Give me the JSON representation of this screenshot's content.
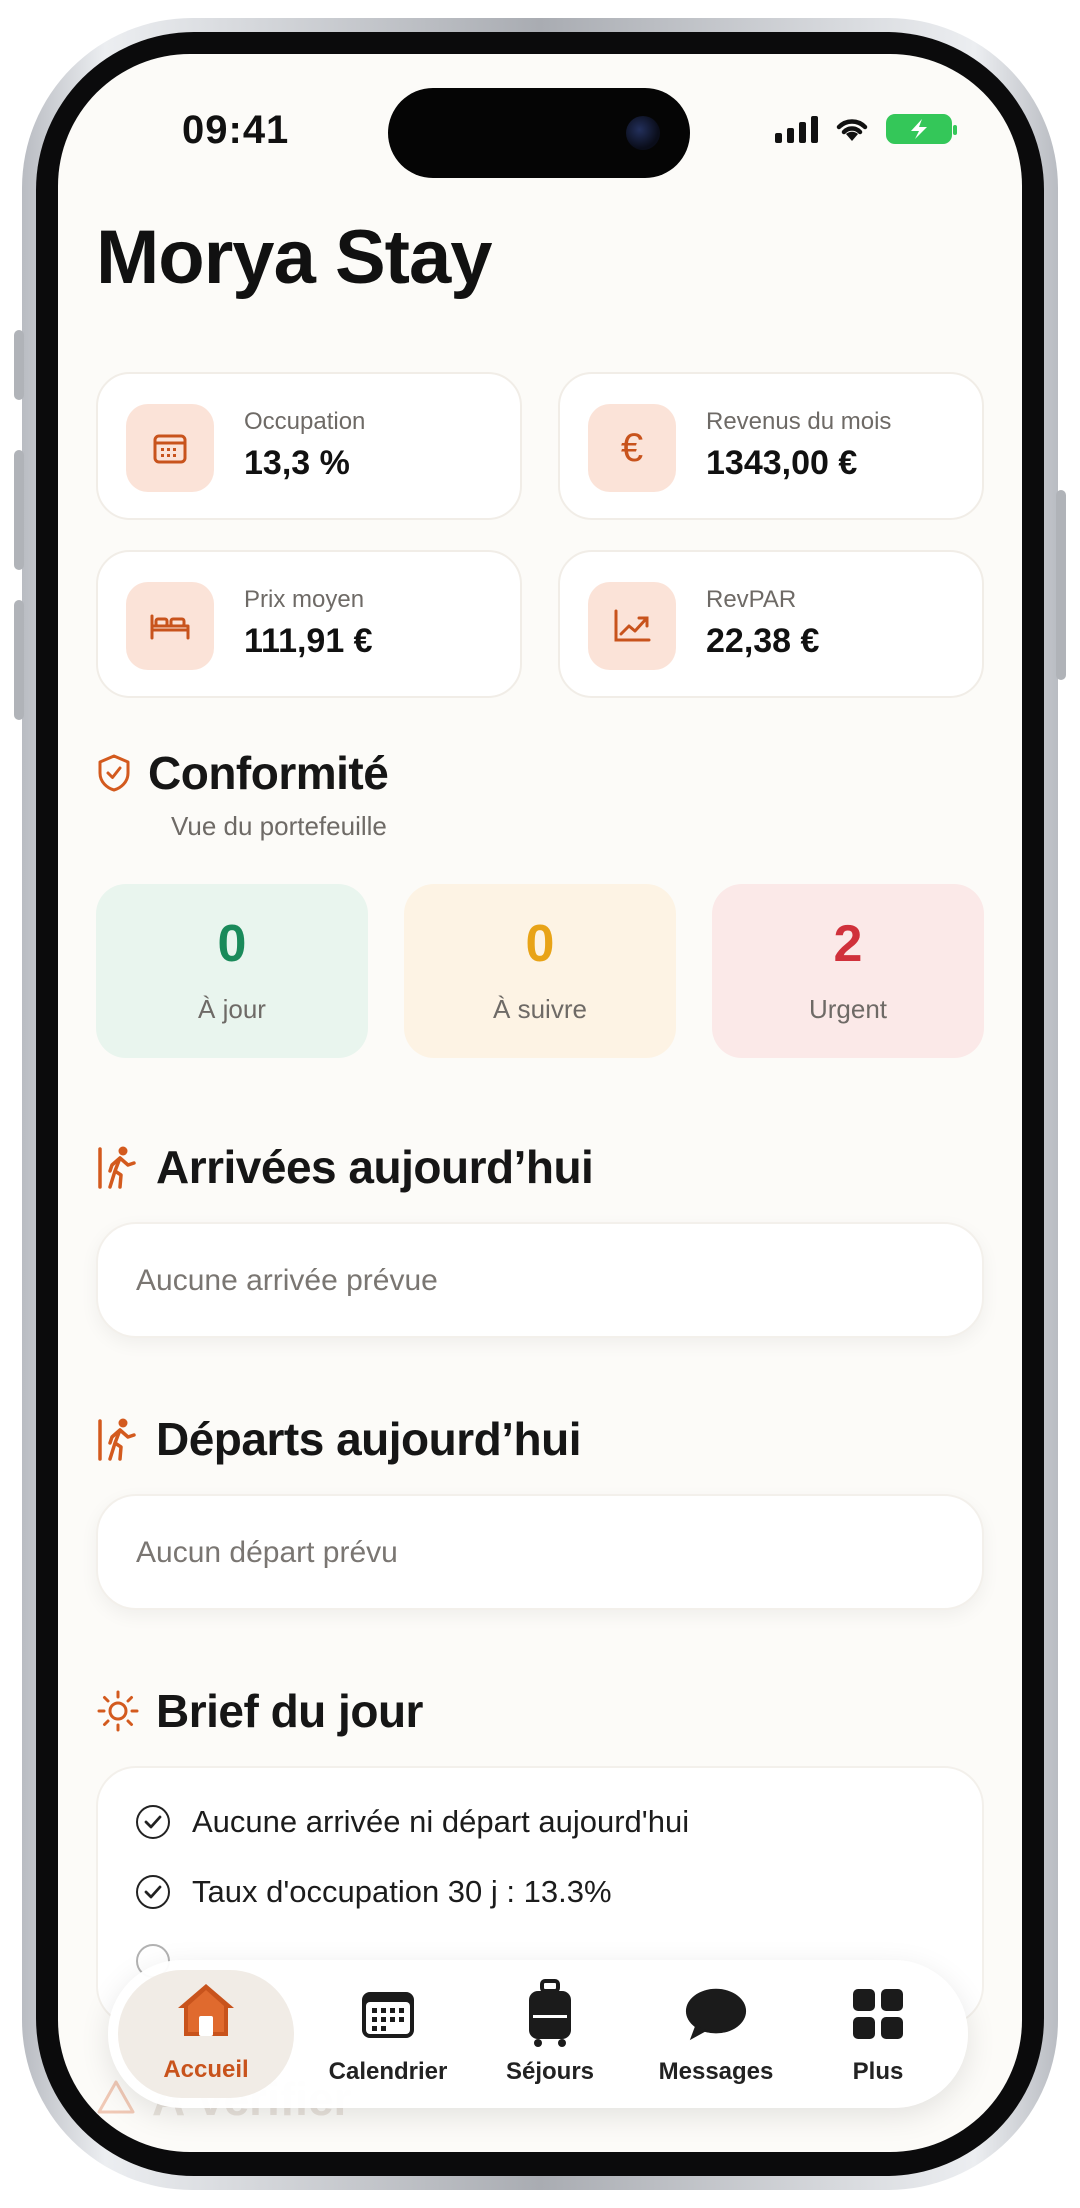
{
  "status_bar": {
    "time": "09:41"
  },
  "app": {
    "title": "Morya Stay"
  },
  "kpis": [
    {
      "label": "Occupation",
      "value": "13,3 %",
      "icon": "calendar-icon"
    },
    {
      "label": "Revenus du mois",
      "value": "1343,00 €",
      "icon": "euro-icon"
    },
    {
      "label": "Prix moyen",
      "value": "111,91 €",
      "icon": "bed-icon"
    },
    {
      "label": "RevPAR",
      "value": "22,38 €",
      "icon": "trend-chart-icon"
    }
  ],
  "compliance": {
    "title": "Conformité",
    "subtitle": "Vue du portefeuille",
    "cards": [
      {
        "count": "0",
        "label": "À jour",
        "color": "#1a8a5a",
        "bg": "#e9f5ee"
      },
      {
        "count": "0",
        "label": "À suivre",
        "color": "#e8a317",
        "bg": "#fdf3e4"
      },
      {
        "count": "2",
        "label": "Urgent",
        "color": "#d0313b",
        "bg": "#fbe9e8"
      }
    ]
  },
  "arrivals": {
    "title": "Arrivées aujourd’hui",
    "empty": "Aucune arrivée prévue"
  },
  "departures": {
    "title": "Départs aujourd’hui",
    "empty": "Aucun départ prévu"
  },
  "brief": {
    "title": "Brief du jour",
    "items": [
      "Aucune arrivée ni départ aujourd'hui",
      "Taux d'occupation 30 j : 13.3%"
    ]
  },
  "next_section": {
    "title": "À vérifier"
  },
  "tabbar": {
    "active_color": "#c8531c",
    "tabs": [
      {
        "label": "Accueil",
        "icon": "home-icon",
        "active": true
      },
      {
        "label": "Calendrier",
        "icon": "calendar-icon",
        "active": false
      },
      {
        "label": "Séjours",
        "icon": "luggage-icon",
        "active": false
      },
      {
        "label": "Messages",
        "icon": "chat-bubble-icon",
        "active": false
      },
      {
        "label": "Plus",
        "icon": "grid-icon",
        "active": false
      }
    ]
  }
}
